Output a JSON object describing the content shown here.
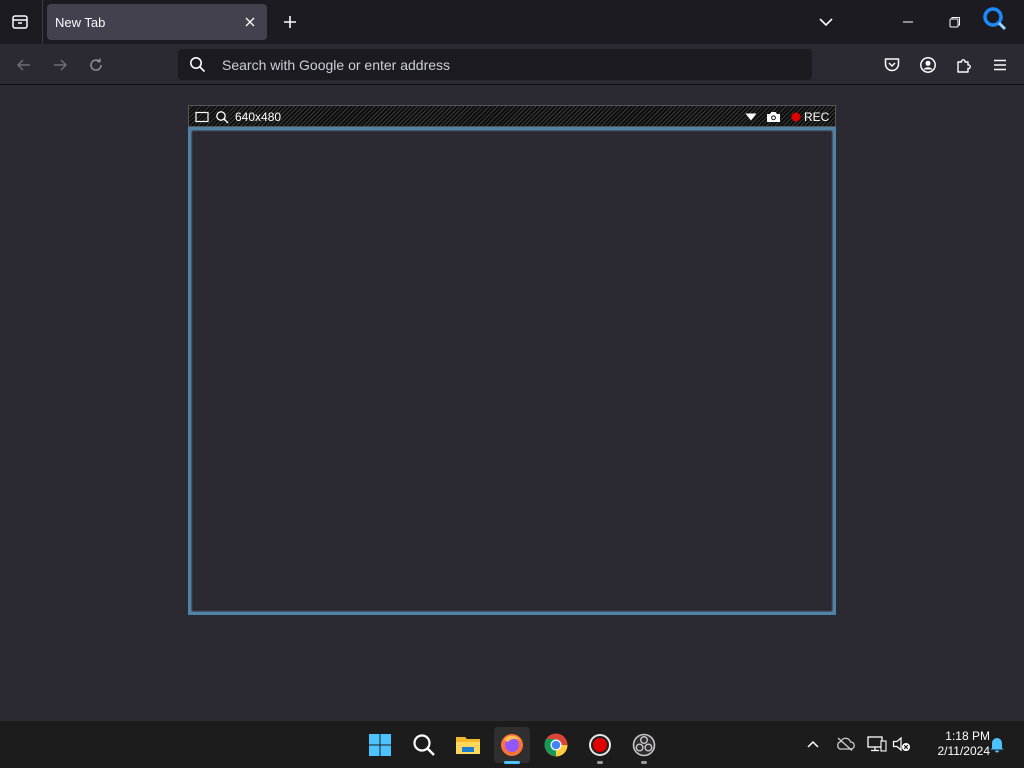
{
  "browser": {
    "tab": {
      "title": "New Tab"
    },
    "urlbar": {
      "placeholder": "Search with Google or enter address",
      "value": ""
    }
  },
  "recorder": {
    "size_label": "640x480",
    "record_label": "REC",
    "frame_color": "#4f84a8",
    "record_dot_color": "#e00000"
  },
  "taskbar": {
    "apps": [
      {
        "name": "start",
        "icon": "windows-logo-icon"
      },
      {
        "name": "search",
        "icon": "search-icon"
      },
      {
        "name": "file-explorer",
        "icon": "folder-icon"
      },
      {
        "name": "firefox",
        "icon": "firefox-icon",
        "active": true
      },
      {
        "name": "chrome",
        "icon": "chrome-icon"
      },
      {
        "name": "recorder",
        "icon": "record-icon"
      },
      {
        "name": "obs",
        "icon": "obs-icon"
      }
    ],
    "clock": {
      "time": "1:18 PM",
      "date": "2/11/2024"
    }
  },
  "colors": {
    "tabstrip_bg": "#1c1b22",
    "toolbar_bg": "#2b2a33",
    "tab_active_bg": "#42414d",
    "taskbar_bg": "#1c1c1c",
    "accent": "#4cc2ff"
  }
}
